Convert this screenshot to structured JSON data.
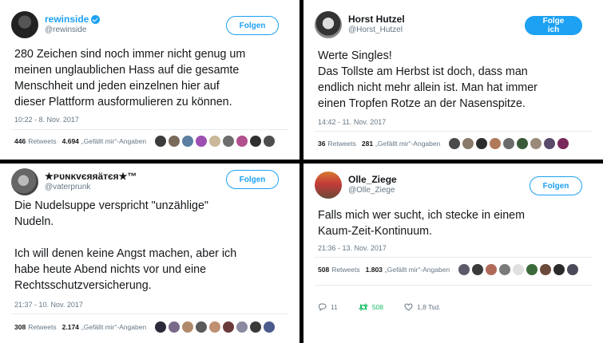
{
  "tweets": [
    {
      "display_name": "rewinside",
      "handle": "@rewinside",
      "verified": true,
      "follow_label": "Folgen",
      "text": "280 Zeichen sind noch immer nicht genug um\nmeinen unglaublichen Hass auf die gesamte\nMenschheit und jeden einzelnen hier auf\ndieser Plattform ausformulieren zu können.",
      "time": "10:22 - 8. Nov. 2017",
      "retweets": "446",
      "retweets_label": "Retweets",
      "likes": "4.694",
      "likes_label": "„Gefällt mir“-Angaben",
      "liker_colors": [
        "#3b3b3b",
        "#7a6a5a",
        "#5a7fa0",
        "#9c4fb0",
        "#c9b89a",
        "#6d6d6d",
        "#b0508f",
        "#2f2f2f",
        "#4d4d4d"
      ]
    },
    {
      "display_name": "Horst Hutzel",
      "handle": "@Horst_Hutzel",
      "verified": false,
      "follow_label": "Folge ich",
      "text": "Werte Singles!\nDas Tollste am Herbst ist doch, dass man\nendlich nicht mehr allein ist. Man hat immer\neinen Tropfen Rotze an der Nasenspitze.",
      "time": "14:42 - 11. Nov. 2017",
      "retweets": "36",
      "retweets_label": "Retweets",
      "likes": "281",
      "likes_label": "„Gefällt mir“-Angaben",
      "liker_colors": [
        "#4a4a4a",
        "#8a7a6a",
        "#2d2d2d",
        "#b07a5a",
        "#6a6a6a",
        "#3a5a3a",
        "#9a8a7a",
        "#5a4a6a",
        "#7a2a5a"
      ]
    },
    {
      "display_name": "★ᴘυɴĸvєяяäтєя★™",
      "handle": "@vaterprunk",
      "verified": false,
      "follow_label": "Folgen",
      "text": "Die Nudelsuppe verspricht \"unzählige\"\nNudeln.\n\nIch will denen keine Angst machen, aber ich\nhabe heute Abend nichts vor und eine\nRechtsschutzversicherung.",
      "time": "21:37 - 10. Nov. 2017",
      "retweets": "308",
      "retweets_label": "Retweets",
      "likes": "2.174",
      "likes_label": "„Gefällt mir“-Angaben",
      "liker_colors": [
        "#2a2a3a",
        "#7a6a8a",
        "#b08a6a",
        "#5a5a5a",
        "#c09070",
        "#6a3a3a",
        "#8a8aa0",
        "#3a3a3a",
        "#4a5a8a"
      ]
    },
    {
      "display_name": "Olle_Ziege",
      "handle": "@Olle_Ziege",
      "verified": false,
      "follow_label": "Folgen",
      "text": "Falls mich wer sucht, ich stecke in einem\nKaum-Zeit-Kontinuum.",
      "time": "21:36 - 13. Nov. 2017",
      "retweets": "508",
      "retweets_label": "Retweets",
      "likes": "1.803",
      "likes_label": "„Gefällt mir“-Angaben",
      "liker_colors": [
        "#5a5a6a",
        "#3a3a3a",
        "#b06a5a",
        "#7a7a7a",
        "#e0e0e0",
        "#3a6a3a",
        "#6a4a3a",
        "#2a2a2a",
        "#4a4a5a"
      ],
      "reply_count": "11",
      "retweet_count": "508",
      "like_count": "1,8 Tsd."
    }
  ]
}
